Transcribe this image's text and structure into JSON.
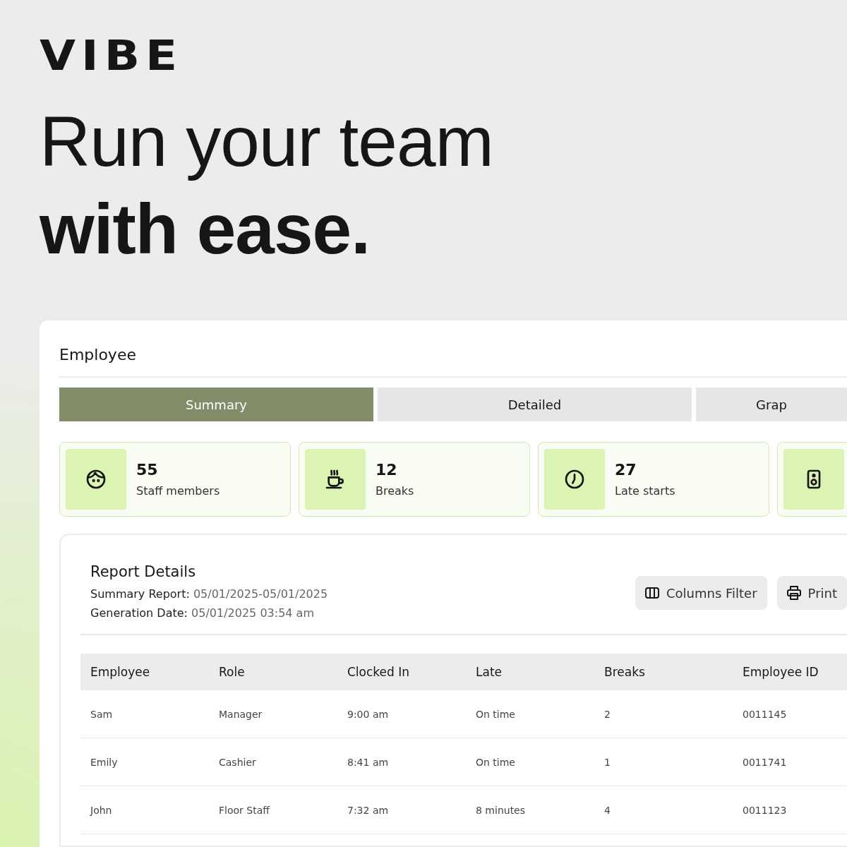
{
  "brand": {
    "logo": "VIBE",
    "headline_light": "Run your team",
    "headline_bold": "with ease."
  },
  "panel": {
    "title": "Employee",
    "tabs": [
      {
        "label": "Summary",
        "selected": true
      },
      {
        "label": "Detailed",
        "selected": false
      },
      {
        "label": "Grap",
        "selected": false
      }
    ],
    "stats": [
      {
        "kind": "face",
        "value": "55",
        "label": "Staff members"
      },
      {
        "kind": "cup",
        "value": "12",
        "label": "Breaks"
      },
      {
        "kind": "clock",
        "value": "27",
        "label": "Late starts"
      },
      {
        "kind": "speaker"
      }
    ],
    "report": {
      "title": "Report Details",
      "meta": [
        {
          "label": "Summary Report:",
          "value": "05/01/2025-05/01/2025"
        },
        {
          "label": "Generation Date:",
          "value": "05/01/2025 03:54 am"
        }
      ],
      "buttons": [
        {
          "kind": "columns",
          "label": "Columns Filter"
        },
        {
          "kind": "printer",
          "label": "Print"
        }
      ],
      "table": {
        "columns": [
          "Employee",
          "Role",
          "Clocked In",
          "Late",
          "Breaks",
          "Employee ID"
        ],
        "rows": [
          [
            "Sam",
            "Manager",
            "9:00 am",
            "On time",
            "2",
            "0011145"
          ],
          [
            "Emily",
            "Cashier",
            "8:41 am",
            "On time",
            "1",
            "0011741"
          ],
          [
            "John",
            "Floor Staff",
            "7:32 am",
            "8 minutes",
            "4",
            "0011123"
          ]
        ]
      }
    }
  }
}
